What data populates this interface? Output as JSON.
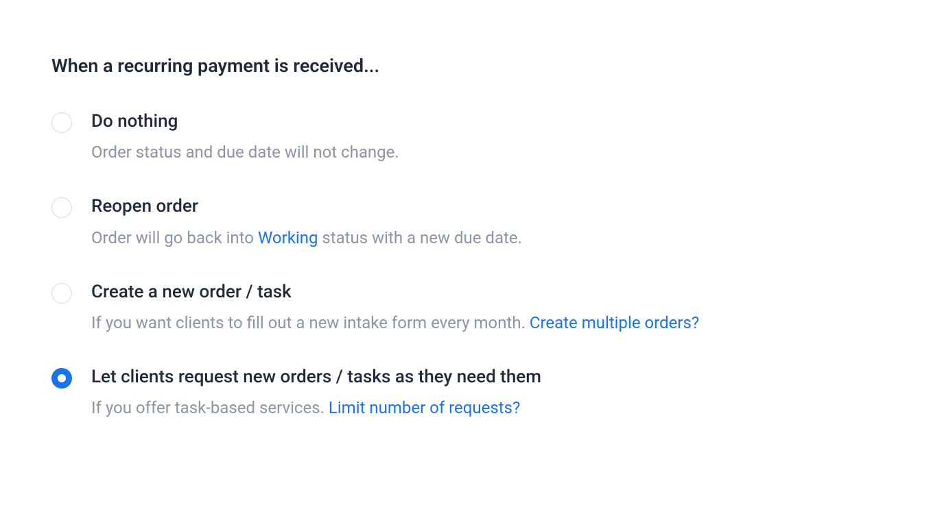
{
  "heading": "When a recurring payment is received...",
  "options": [
    {
      "title": "Do nothing",
      "desc_pre": "Order status and due date will not change.",
      "link_inline": "",
      "desc_post": "",
      "link_trailing": "",
      "selected": false
    },
    {
      "title": "Reopen order",
      "desc_pre": "Order will go back into ",
      "link_inline": "Working",
      "desc_post": " status with a new due date.",
      "link_trailing": "",
      "selected": false
    },
    {
      "title": "Create a new order / task",
      "desc_pre": "If you want clients to fill out a new intake form every month. ",
      "link_inline": "",
      "desc_post": "",
      "link_trailing": "Create multiple orders?",
      "selected": false
    },
    {
      "title": "Let clients request new orders / tasks as they need them",
      "desc_pre": "If you offer task-based services. ",
      "link_inline": "",
      "desc_post": "",
      "link_trailing": "Limit number of requests?",
      "selected": true
    }
  ]
}
